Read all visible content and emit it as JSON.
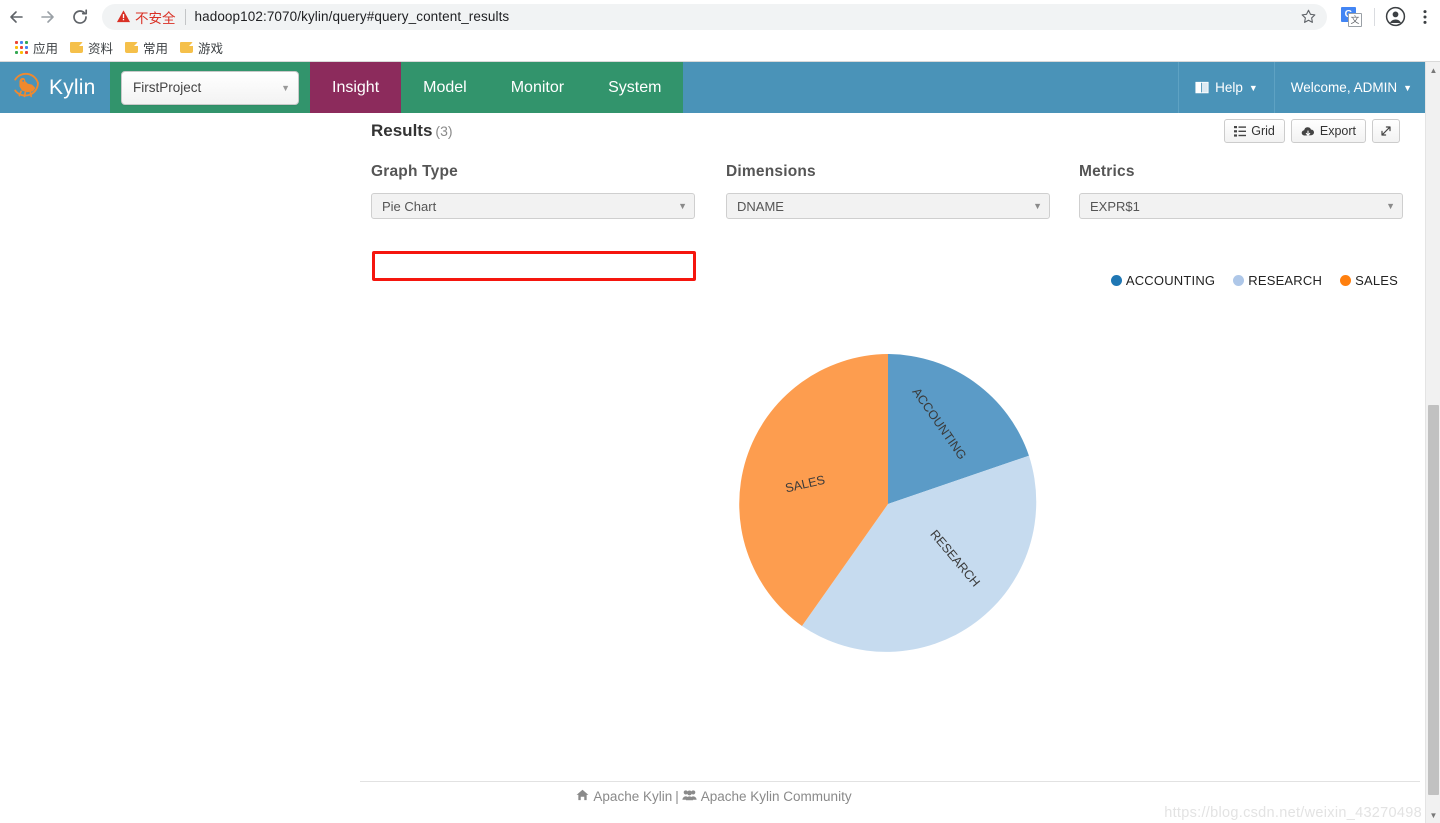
{
  "browser": {
    "back_icon": "back-arrow-icon",
    "forward_icon": "forward-arrow-icon",
    "reload_icon": "reload-icon",
    "security_label": "不安全",
    "url": "hadoop102:7070/kylin/query#query_content_results",
    "star_icon": "bookmark-star-icon",
    "translate_icon": "translate-icon",
    "profile_icon": "profile-avatar-icon",
    "menu_icon": "three-dot-menu-icon",
    "bookmarks": [
      {
        "label": "应用",
        "icon": "apps-grid-icon"
      },
      {
        "label": "资料",
        "icon": "folder-icon"
      },
      {
        "label": "常用",
        "icon": "folder-icon"
      },
      {
        "label": "游戏",
        "icon": "folder-icon"
      }
    ]
  },
  "app_header": {
    "brand": "Kylin",
    "brand_logo_icon": "kylin-logo-icon",
    "project": "FirstProject",
    "tabs": [
      {
        "label": "Insight",
        "active": true
      },
      {
        "label": "Model",
        "active": false
      },
      {
        "label": "Monitor",
        "active": false
      },
      {
        "label": "System",
        "active": false
      }
    ],
    "help": "Help",
    "help_icon": "book-icon",
    "user": "Welcome, ADMIN",
    "caret": "▾"
  },
  "results": {
    "title": "Results",
    "count": "(3)",
    "grid_button": "Grid",
    "grid_icon": "list-grid-icon",
    "export_button": "Export",
    "export_icon": "cloud-download-icon",
    "expand_icon": "expand-arrows-icon"
  },
  "controls": [
    {
      "label": "Graph Type",
      "value": "Pie Chart",
      "name": "graph-type-select",
      "highlighted": true
    },
    {
      "label": "Dimensions",
      "value": "DNAME",
      "name": "dimensions-select",
      "highlighted": false
    },
    {
      "label": "Metrics",
      "value": "EXPR$1",
      "name": "metrics-select",
      "highlighted": false
    }
  ],
  "chart_data": {
    "type": "pie",
    "title": "",
    "categories": [
      "ACCOUNTING",
      "RESEARCH",
      "SALES"
    ],
    "values": [
      19.4,
      40.3,
      40.3
    ],
    "percentages": [
      19.4,
      40.3,
      40.3
    ],
    "slice_colors": [
      "#5b9bc7",
      "#c6dbef",
      "#fd9d4f"
    ],
    "legend_colors": [
      "#1f77b4",
      "#aec7e8",
      "#ff7f0e"
    ],
    "legend_position": "top-right",
    "start_angle_deg": 0,
    "angles_deg": [
      70,
      145,
      145
    ],
    "grid": false,
    "xlabel": "",
    "ylabel": ""
  },
  "footer": {
    "home_icon": "home-icon",
    "link1": "Apache Kylin",
    "separator": "|",
    "community_icon": "users-group-icon",
    "link2": "Apache Kylin Community",
    "watermark": "https://blog.csdn.net/weixin_43270498"
  },
  "colors": {
    "header_blue": "#4a93b8",
    "tab_green": "#32946c",
    "tab_active": "#8c2b5c",
    "highlight_red": "#f5160e"
  }
}
